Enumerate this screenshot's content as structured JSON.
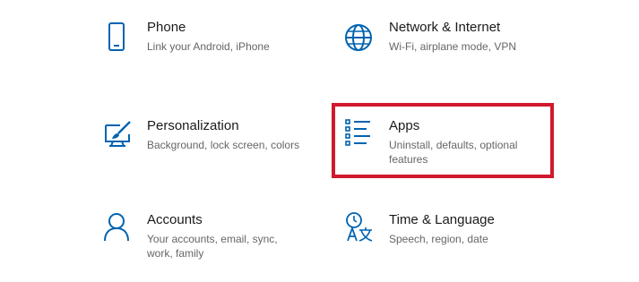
{
  "colors": {
    "accent": "#0063b1",
    "title_text": "#1a1a1a",
    "description_text": "#666666",
    "highlight": "#d0192d",
    "background": "#ffffff"
  },
  "tiles": [
    {
      "title": "Phone",
      "description": "Link your Android, iPhone",
      "icon": "phone-icon"
    },
    {
      "title": "Network & Internet",
      "description": "Wi-Fi, airplane mode, VPN",
      "icon": "globe-icon"
    },
    {
      "title": "Personalization",
      "description": "Background, lock screen, colors",
      "icon": "paintbrush-monitor-icon"
    },
    {
      "title": "Apps",
      "description": "Uninstall, defaults, optional features",
      "icon": "apps-list-icon",
      "highlighted": true
    },
    {
      "title": "Accounts",
      "description": "Your accounts, email, sync, work, family",
      "icon": "person-icon"
    },
    {
      "title": "Time & Language",
      "description": "Speech, region, date",
      "icon": "time-language-icon"
    }
  ]
}
